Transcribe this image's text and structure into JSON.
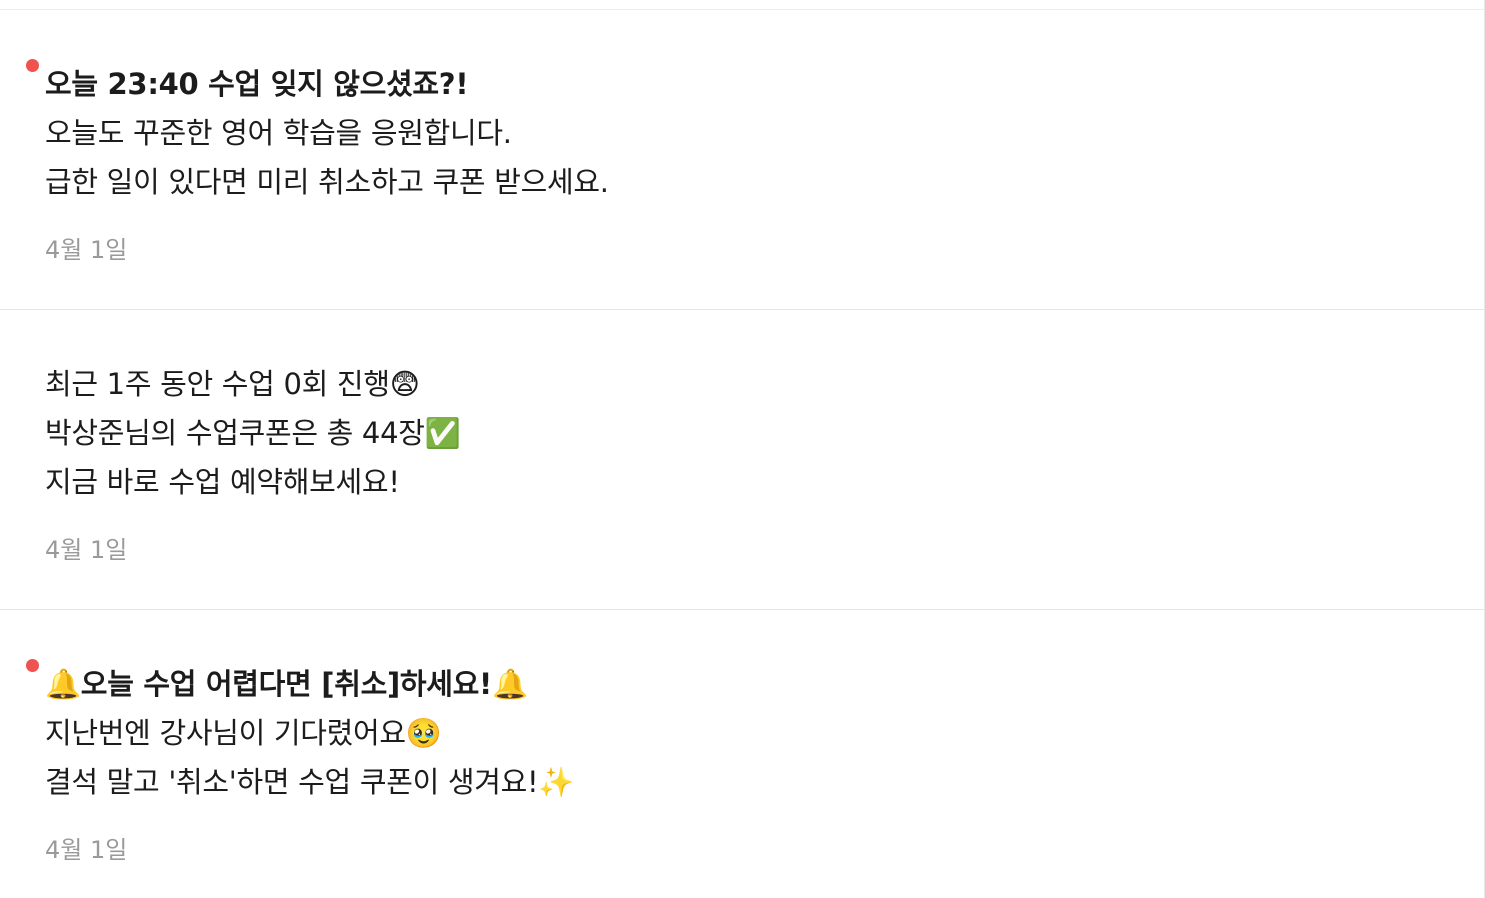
{
  "notifications": [
    {
      "unread": true,
      "lines": [
        "오늘 23:40 수업 잊지 않으셨죠?!",
        "오늘도 꾸준한 영어 학습을 응원합니다.",
        "급한 일이 있다면 미리 취소하고 쿠폰 받으세요."
      ],
      "date": "4월 1일"
    },
    {
      "unread": false,
      "lines": [
        "최근 1주 동안 수업 0회 진행😨",
        "박상준님의 수업쿠폰은 총 44장✅",
        "지금 바로 수업 예약해보세요!"
      ],
      "date": "4월 1일"
    },
    {
      "unread": true,
      "lines": [
        "🔔오늘 수업 어렵다면 [취소]하세요!🔔",
        "지난번엔 강사님이 기다렸어요🥹",
        "결석 말고 '취소'하면 수업 쿠폰이 생겨요!✨"
      ],
      "date": "4월 1일"
    }
  ],
  "colors": {
    "unread_dot": "#f0524f",
    "date_text": "#9a9a9a",
    "divider": "#e6e6e6"
  }
}
